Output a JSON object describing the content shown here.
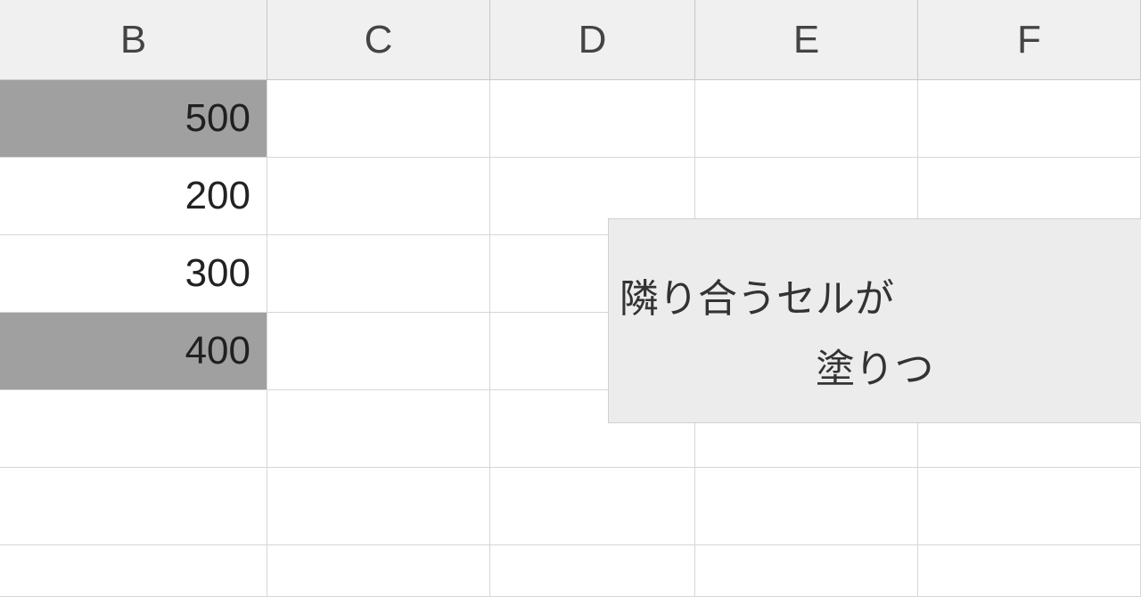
{
  "columns": [
    "B",
    "C",
    "D",
    "E",
    "F"
  ],
  "rows": [
    {
      "B": "500",
      "highlighted": true
    },
    {
      "B": "200",
      "highlighted": false
    },
    {
      "B": "300",
      "highlighted": false
    },
    {
      "B": "400",
      "highlighted": true
    },
    {
      "B": "",
      "highlighted": false
    },
    {
      "B": "",
      "highlighted": false
    },
    {
      "B": "",
      "highlighted": false
    }
  ],
  "annotation": {
    "line1": "隣り合うセルが",
    "line2": "塗りつ"
  }
}
